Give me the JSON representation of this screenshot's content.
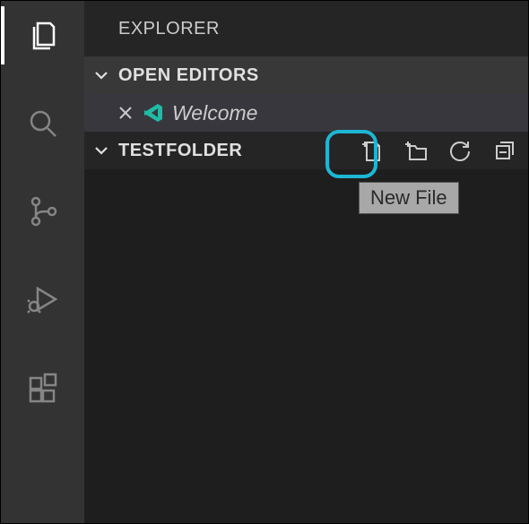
{
  "sidebar": {
    "title": "EXPLORER"
  },
  "openEditors": {
    "label": "OPEN EDITORS",
    "items": [
      {
        "name": "Welcome"
      }
    ]
  },
  "folder": {
    "name": "TESTFOLDER",
    "actions": {
      "newFile": "New File",
      "newFolder": "New Folder",
      "refresh": "Refresh",
      "collapse": "Collapse All"
    }
  },
  "tooltip": {
    "text": "New File"
  },
  "colors": {
    "highlight": "#1db7d4",
    "logo": "#20baa5"
  }
}
